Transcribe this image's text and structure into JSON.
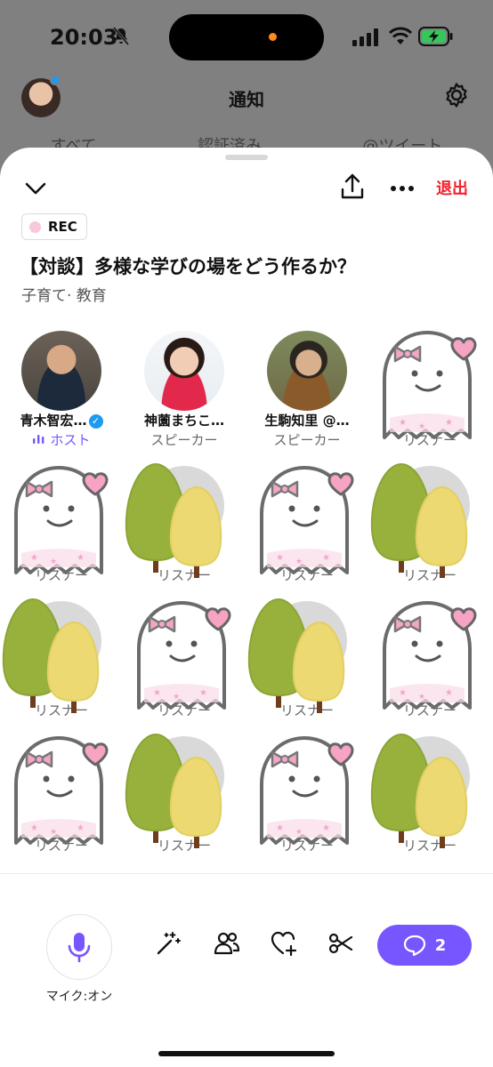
{
  "status_bar": {
    "time": "20:03"
  },
  "background": {
    "title": "通知",
    "tabs": [
      "すべて",
      "認証済み",
      "@ツイート"
    ]
  },
  "sheet": {
    "leave_label": "退出",
    "rec_label": "REC",
    "title": "【対談】多様な学びの場をどう作るか？",
    "category": "子育て· 教育"
  },
  "participants": [
    {
      "name": "青木智宏…",
      "role": "ホスト",
      "verified": true
    },
    {
      "name": "神薗まちこ…",
      "role": "スピーカー",
      "verified": false
    },
    {
      "name": "生駒知里 @…",
      "role": "スピーカー",
      "verified": false
    },
    {
      "name": "",
      "role": "リスナー",
      "verified": false
    },
    {
      "name": "",
      "role": "リスナー",
      "verified": true
    },
    {
      "name": "",
      "role": "リスナー",
      "verified": true
    },
    {
      "name": "",
      "role": "リスナー",
      "verified": false
    },
    {
      "name": "",
      "role": "リスナー",
      "verified": false
    },
    {
      "name": "",
      "role": "リスナー",
      "verified": false
    },
    {
      "name": "",
      "role": "リスナー",
      "verified": false
    },
    {
      "name": "",
      "role": "リスナー",
      "verified": false
    },
    {
      "name": "",
      "role": "リスナー",
      "verified": false
    },
    {
      "name": "",
      "role": "リスナー",
      "verified": false
    },
    {
      "name": "",
      "role": "リスナー",
      "verified": false
    },
    {
      "name": "",
      "role": "リスナー",
      "verified": false
    },
    {
      "name": "",
      "role": "リスナー",
      "verified": false
    }
  ],
  "bottom_bar": {
    "mic_label": "マイク:オン",
    "comments_count": "2"
  },
  "colors": {
    "accent": "#7856ff",
    "leave": "#f4212e",
    "verified": "#1d9bf0"
  }
}
